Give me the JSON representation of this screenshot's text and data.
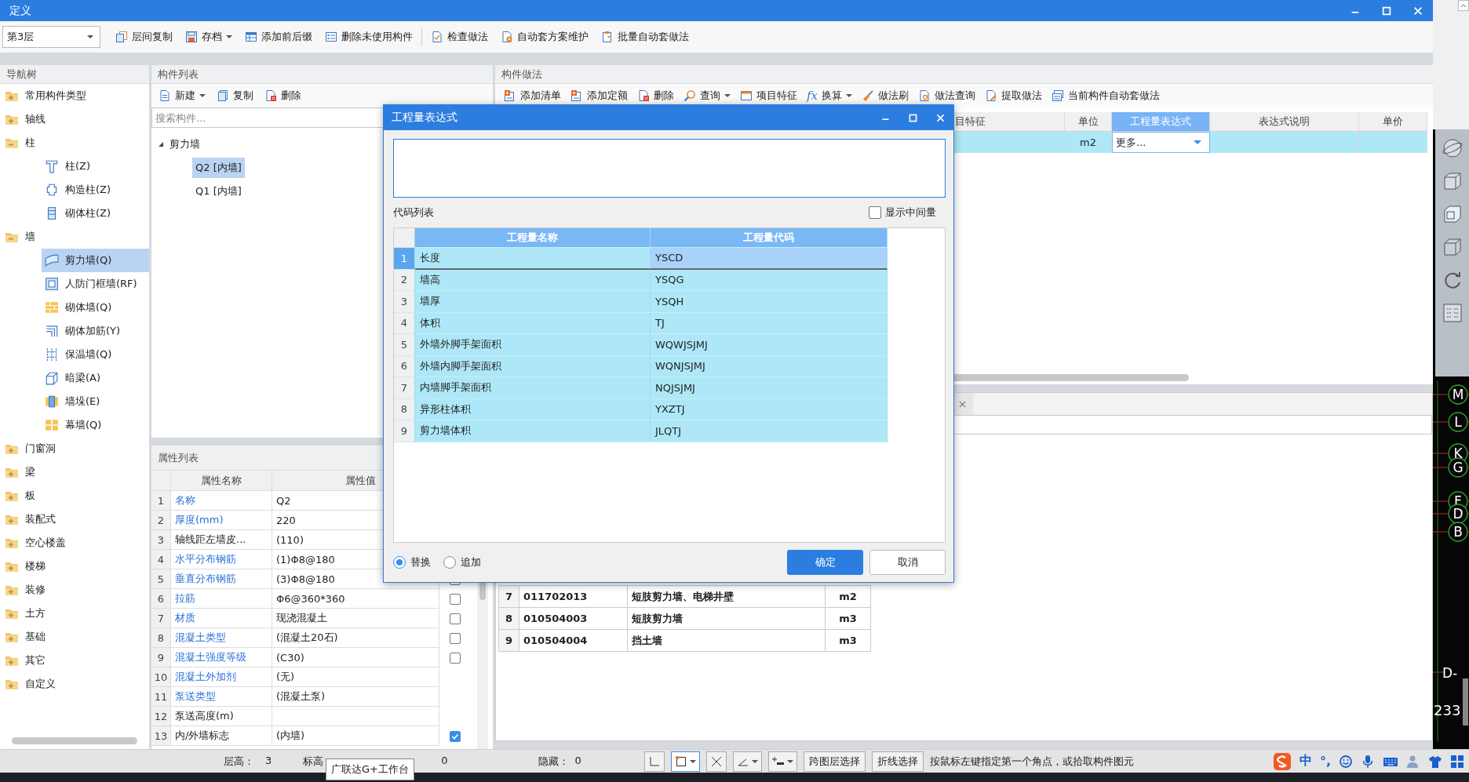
{
  "window": {
    "title": "定义"
  },
  "toolbar": {
    "floor_select": "第3层",
    "buttons": [
      {
        "label": "层间复制",
        "dropdown": false
      },
      {
        "label": "存档",
        "dropdown": true
      },
      {
        "label": "添加前后缀",
        "dropdown": false
      },
      {
        "label": "删除未使用构件",
        "dropdown": false
      },
      {
        "label": "检查做法",
        "dropdown": false
      },
      {
        "label": "自动套方案维护",
        "dropdown": false
      },
      {
        "label": "批量自动套做法",
        "dropdown": false
      }
    ]
  },
  "nav_tree": {
    "title": "导航树",
    "items": [
      {
        "label": "常用构件类型",
        "expanded": false,
        "selected": false
      },
      {
        "label": "轴线",
        "expanded": false,
        "selected": false
      },
      {
        "label": "柱",
        "expanded": true,
        "selected": false,
        "children": [
          {
            "label": "柱(Z)",
            "selected": false
          },
          {
            "label": "构造柱(Z)",
            "selected": false
          },
          {
            "label": "砌体柱(Z)",
            "selected": false
          }
        ]
      },
      {
        "label": "墙",
        "expanded": true,
        "selected": false,
        "children": [
          {
            "label": "剪力墙(Q)",
            "selected": true
          },
          {
            "label": "人防门框墙(RF)",
            "selected": false
          },
          {
            "label": "砌体墙(Q)",
            "selected": false
          },
          {
            "label": "砌体加筋(Y)",
            "selected": false
          },
          {
            "label": "保温墙(Q)",
            "selected": false
          },
          {
            "label": "暗梁(A)",
            "selected": false
          },
          {
            "label": "墙垛(E)",
            "selected": false
          },
          {
            "label": "幕墙(Q)",
            "selected": false
          }
        ]
      },
      {
        "label": "门窗洞",
        "expanded": false,
        "selected": false
      },
      {
        "label": "梁",
        "expanded": false,
        "selected": false
      },
      {
        "label": "板",
        "expanded": false,
        "selected": false
      },
      {
        "label": "装配式",
        "expanded": false,
        "selected": false
      },
      {
        "label": "空心楼盖",
        "expanded": false,
        "selected": false
      },
      {
        "label": "楼梯",
        "expanded": false,
        "selected": false
      },
      {
        "label": "装修",
        "expanded": false,
        "selected": false
      },
      {
        "label": "土方",
        "expanded": false,
        "selected": false
      },
      {
        "label": "基础",
        "expanded": false,
        "selected": false
      },
      {
        "label": "其它",
        "expanded": false,
        "selected": false
      },
      {
        "label": "自定义",
        "expanded": false,
        "selected": false
      }
    ]
  },
  "component_list": {
    "title": "构件列表",
    "toolbar": [
      {
        "label": "新建",
        "dropdown": true
      },
      {
        "label": "复制",
        "dropdown": false
      },
      {
        "label": "删除",
        "dropdown": false
      }
    ],
    "search": {
      "placeholder": "搜索构件..."
    },
    "tree": [
      {
        "label": "剪力墙",
        "expanded": true,
        "children": [
          {
            "label": "Q2 [内墙]",
            "selected": true
          },
          {
            "label": "Q1 [内墙]",
            "selected": false
          }
        ]
      }
    ]
  },
  "property_list": {
    "title": "属性列表",
    "columns": [
      "属性名称",
      "属性值"
    ],
    "rows": [
      {
        "index": "1",
        "name": "名称",
        "value": "Q2",
        "public": true
      },
      {
        "index": "2",
        "name": "厚度(mm)",
        "value": "220",
        "public": true
      },
      {
        "index": "3",
        "name": "轴线距左墙皮...",
        "value": "(110)",
        "public": false
      },
      {
        "index": "4",
        "name": "水平分布钢筋",
        "value": "(1)Φ8@180",
        "public": true
      },
      {
        "index": "5",
        "name": "垂直分布钢筋",
        "value": "(3)Φ8@180",
        "public": true,
        "checked": false
      },
      {
        "index": "6",
        "name": "拉筋",
        "value": "Φ6@360*360",
        "public": true,
        "checked": false
      },
      {
        "index": "7",
        "name": "材质",
        "value": "现浇混凝土",
        "public": true,
        "checked": false
      },
      {
        "index": "8",
        "name": "混凝土类型",
        "value": "(混凝土20石)",
        "public": true,
        "checked": false
      },
      {
        "index": "9",
        "name": "混凝土强度等级",
        "value": "(C30)",
        "public": true,
        "checked": false
      },
      {
        "index": "10",
        "name": "混凝土外加剂",
        "value": "(无)",
        "public": true
      },
      {
        "index": "11",
        "name": "泵送类型",
        "value": "(混凝土泵)",
        "public": true
      },
      {
        "index": "12",
        "name": "泵送高度(m)",
        "public": false
      },
      {
        "index": "13",
        "name": "内/外墙标志",
        "value": "(内墙)",
        "public": false,
        "checked": true
      }
    ]
  },
  "methods": {
    "title": "构件做法",
    "toolbar": [
      {
        "label": "添加清单",
        "dropdown": false
      },
      {
        "label": "添加定额",
        "dropdown": false
      },
      {
        "label": "删除",
        "dropdown": false
      },
      {
        "label": "查询",
        "dropdown": true
      },
      {
        "label": "项目特征",
        "dropdown": false
      },
      {
        "icon_text": "fx",
        "label": "换算",
        "dropdown": true
      },
      {
        "label": "做法刷",
        "dropdown": false
      },
      {
        "label": "做法查询",
        "dropdown": false
      },
      {
        "label": "提取做法",
        "dropdown": false
      },
      {
        "label": "当前构件自动套做法",
        "dropdown": false
      }
    ],
    "table": {
      "columns": [
        {
          "label": "目特征",
          "selected": false
        },
        {
          "label": "单位",
          "selected": false
        },
        {
          "label": "工程量表达式",
          "selected": true
        },
        {
          "label": "表达式说明",
          "selected": false
        },
        {
          "label": "单价",
          "selected": false
        }
      ],
      "rows": [
        {
          "unit": "m2",
          "expression": "更多..."
        }
      ]
    },
    "lower_table": {
      "rows": [
        {
          "index": "7",
          "code": "011702013",
          "name": "短肢剪力墙、电梯井壁",
          "unit": "m2"
        },
        {
          "index": "8",
          "code": "010504003",
          "name": "短肢剪力墙",
          "unit": "m3"
        },
        {
          "index": "9",
          "code": "010504004",
          "name": "挡土墙",
          "unit": "m3"
        }
      ]
    }
  },
  "dialog": {
    "title": "工程量表达式",
    "code_list_label": "代码列表",
    "show_intermediate": {
      "label": "显示中间量",
      "checked": false
    },
    "columns": [
      "工程量名称",
      "工程量代码"
    ],
    "rows": [
      {
        "index": "1",
        "name": "长度",
        "code": "YSCD",
        "selected": true
      },
      {
        "index": "2",
        "name": "墙高",
        "code": "YSQG",
        "selected": false
      },
      {
        "index": "3",
        "name": "墙厚",
        "code": "YSQH",
        "selected": false
      },
      {
        "index": "4",
        "name": "体积",
        "code": "TJ",
        "selected": false
      },
      {
        "index": "5",
        "name": "外墙外脚手架面积",
        "code": "WQWJSJMJ",
        "selected": false
      },
      {
        "index": "6",
        "name": "外墙内脚手架面积",
        "code": "WQNJSJMJ",
        "selected": false
      },
      {
        "index": "7",
        "name": "内墙脚手架面积",
        "code": "NQJSJMJ",
        "selected": false
      },
      {
        "index": "8",
        "name": "异形柱体积",
        "code": "YXZTJ",
        "selected": false
      },
      {
        "index": "9",
        "name": "剪力墙体积",
        "code": "JLQTJ",
        "selected": false
      }
    ],
    "modes": [
      {
        "label": "替换",
        "selected": true
      },
      {
        "label": "追加",
        "selected": false
      }
    ],
    "buttons": [
      {
        "label": "确定",
        "kind": "primary"
      },
      {
        "label": "取消",
        "kind": "secondary"
      }
    ]
  },
  "cad": {
    "axis_labels": [
      "M",
      "L",
      "K",
      "G",
      "F",
      "D",
      "B"
    ],
    "texts": [
      "D-",
      "233"
    ]
  },
  "status_bar": {
    "fields": [
      {
        "label": "层高：",
        "value": "3"
      },
      {
        "label": "标高",
        "value": "0"
      },
      {
        "label": "隐藏：",
        "value": "0"
      }
    ],
    "buttons": [
      "跨图层选择",
      "折线选择"
    ],
    "hint": "按鼠标左键指定第一个角点，或拾取构件图元",
    "ime": [
      "中",
      "°,"
    ]
  },
  "tooltip": "广联达G+工作台"
}
